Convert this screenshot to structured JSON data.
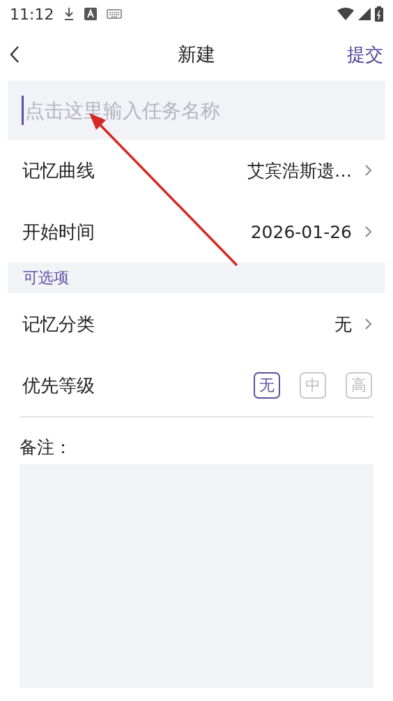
{
  "status_bar": {
    "time": "11:12"
  },
  "header": {
    "title": "新建",
    "action": "提交"
  },
  "task_name": {
    "placeholder": "点击这里输入任务名称"
  },
  "rows": [
    {
      "label": "记忆曲线",
      "value": "艾宾浩斯遗…"
    },
    {
      "label": "开始时间",
      "value": "2026-01-26"
    }
  ],
  "optional_section": {
    "title": "可选项"
  },
  "optional_rows": [
    {
      "label": "记忆分类",
      "value": "无"
    }
  ],
  "priority": {
    "label": "优先等级",
    "options": [
      {
        "label": "无",
        "selected": true
      },
      {
        "label": "中",
        "selected": false
      },
      {
        "label": "高",
        "selected": false
      }
    ]
  },
  "notes": {
    "label": "备注："
  }
}
